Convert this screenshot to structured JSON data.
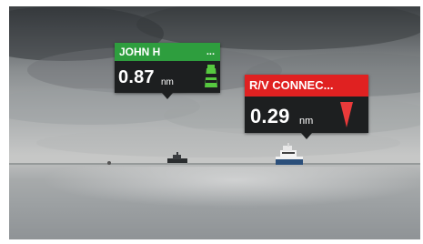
{
  "colors": {
    "john_h_header": "#2e9e3e",
    "rv_header": "#e02121",
    "card_body": "#1d1f20",
    "green_icon": "#56c93f",
    "red_icon": "#ea3a3a"
  },
  "targets": [
    {
      "name": "JOHN H",
      "more": "...",
      "distance": "0.87",
      "unit": "nm",
      "icon": "green-buoy-icon"
    },
    {
      "name": "R/V CONNEC...",
      "more": "",
      "distance": "0.29",
      "unit": "nm",
      "icon": "red-triangle-icon"
    }
  ]
}
